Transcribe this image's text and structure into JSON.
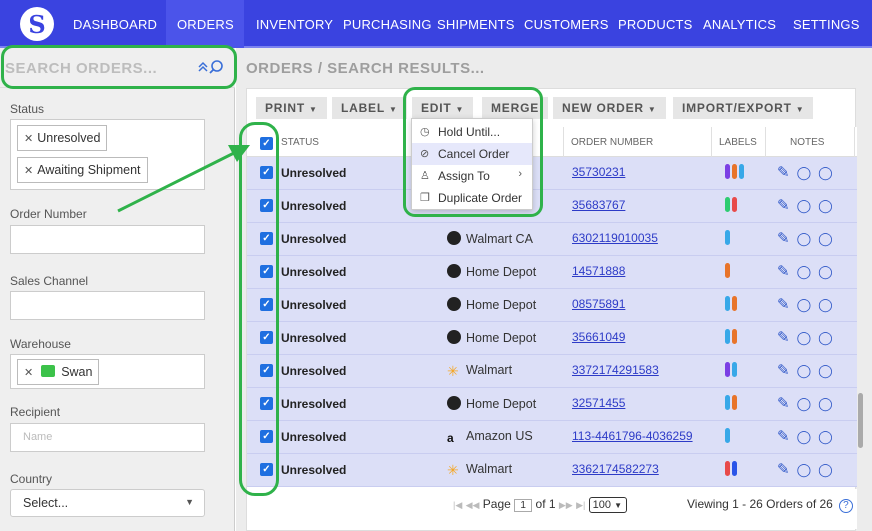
{
  "nav": {
    "logo": "S",
    "items": [
      "DASHBOARD",
      "ORDERS",
      "INVENTORY",
      "PURCHASING",
      "SHIPMENTS",
      "CUSTOMERS",
      "PRODUCTS",
      "ANALYTICS",
      "SETTINGS"
    ],
    "active": "ORDERS"
  },
  "sidebar": {
    "search_placeholder": "SEARCH ORDERS...",
    "status_label": "Status",
    "status_chips": [
      "Unresolved",
      "Awaiting Shipment"
    ],
    "order_number_label": "Order Number",
    "sales_channel_label": "Sales Channel",
    "warehouse_label": "Warehouse",
    "warehouse_chip": "Swan",
    "recipient_label": "Recipient",
    "recipient_placeholder": "Name",
    "country_label": "Country",
    "country_value": "Select..."
  },
  "main": {
    "breadcrumb": "ORDERS / SEARCH RESULTS...",
    "toolbar": [
      "PRINT",
      "LABEL",
      "EDIT",
      "MERGE",
      "NEW ORDER",
      "IMPORT/EXPORT"
    ],
    "columns": {
      "status": "STATUS",
      "order_number": "ORDER NUMBER",
      "labels": "LABELS",
      "notes": "NOTES"
    },
    "edit_menu": [
      "Hold Until...",
      "Cancel Order",
      "Assign To",
      "Duplicate Order"
    ],
    "rows": [
      {
        "status": "Unresolved",
        "channel": "",
        "order": "35730231",
        "labels": [
          "#7b3fe4",
          "#e8742a",
          "#38a8e8"
        ]
      },
      {
        "status": "Unresolved",
        "channel": "",
        "order": "35683767",
        "labels": [
          "#2ecc71",
          "#e84a4a"
        ]
      },
      {
        "status": "Unresolved",
        "channel": "Walmart CA",
        "order": "6302119010035",
        "labels": [
          "#38a8e8"
        ]
      },
      {
        "status": "Unresolved",
        "channel": "Home Depot",
        "order": "14571888",
        "labels": [
          "#e8742a"
        ]
      },
      {
        "status": "Unresolved",
        "channel": "Home Depot",
        "order": "08575891",
        "labels": [
          "#38a8e8",
          "#e8742a"
        ]
      },
      {
        "status": "Unresolved",
        "channel": "Home Depot",
        "order": "35661049",
        "labels": [
          "#38a8e8",
          "#e8742a"
        ]
      },
      {
        "status": "Unresolved",
        "channel": "Walmart",
        "order": "3372174291583",
        "labels": [
          "#7b3fe4",
          "#38a8e8"
        ]
      },
      {
        "status": "Unresolved",
        "channel": "Home Depot",
        "order": "32571455",
        "labels": [
          "#38a8e8",
          "#e8742a"
        ]
      },
      {
        "status": "Unresolved",
        "channel": "Amazon US",
        "order": "113-4461796-4036259",
        "labels": [
          "#38a8e8"
        ]
      },
      {
        "status": "Unresolved",
        "channel": "Walmart",
        "order": "3362174582273",
        "labels": [
          "#e84a4a",
          "#2a55e8"
        ]
      }
    ],
    "pager": {
      "page_label": "Page",
      "page": "1",
      "of_label": "of 1",
      "per_page": "100",
      "viewing": "Viewing 1 - 26 Orders of 26"
    }
  },
  "colors": {
    "nav_bg": "#3a43e0",
    "row_bg": "#dcdff7",
    "annotation": "#2fb24a",
    "link": "#2d3bc7"
  }
}
